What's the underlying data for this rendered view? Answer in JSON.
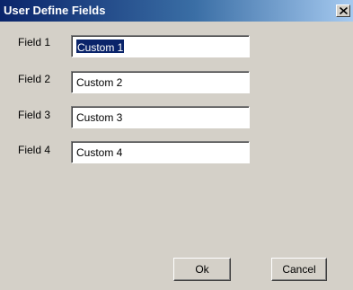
{
  "window": {
    "title": "User Define Fields"
  },
  "icons": {
    "close": "close-icon"
  },
  "fields": [
    {
      "label": "Field 1",
      "value": "Custom 1",
      "selected": true
    },
    {
      "label": "Field 2",
      "value": "Custom 2",
      "selected": false
    },
    {
      "label": "Field 3",
      "value": "Custom 3",
      "selected": false
    },
    {
      "label": "Field 4",
      "value": "Custom 4",
      "selected": false
    }
  ],
  "buttons": {
    "ok_label": "Ok",
    "cancel_label": "Cancel"
  },
  "colors": {
    "title_bar_start": "#0a246a",
    "title_bar_end": "#a6caf0",
    "dialog_face": "#d4d0c8",
    "selection": "#0a246a"
  }
}
